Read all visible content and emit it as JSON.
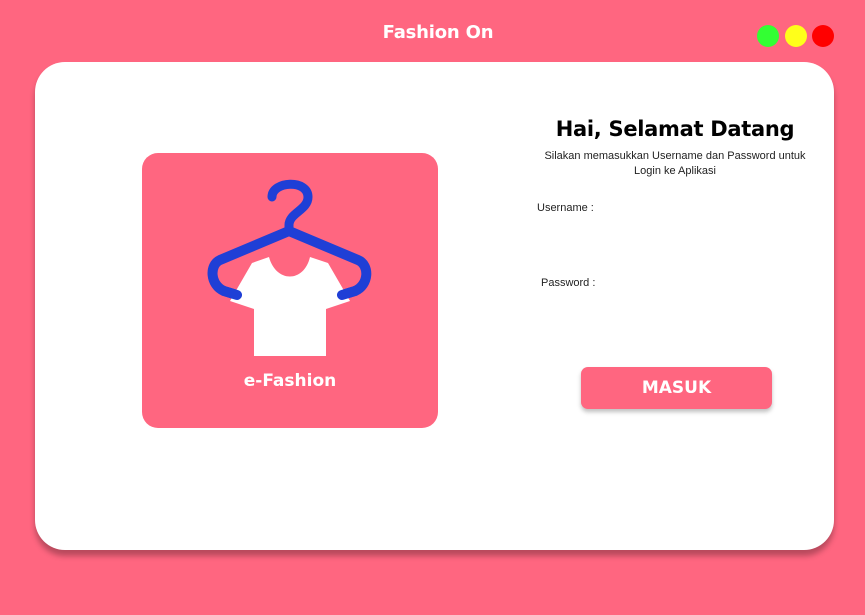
{
  "window": {
    "title": "Fashion On",
    "controls": {
      "green": "#33ff33",
      "yellow": "#ffff1a",
      "red": "#ff0000"
    }
  },
  "colors": {
    "background": "#ff6680",
    "card": "#ffffff",
    "hanger": "#1f3fd6",
    "logo_box": "#ff6680"
  },
  "logo": {
    "icon": "hanger-shirt-icon",
    "text": "e-Fashion"
  },
  "login": {
    "heading": "Hai, Selamat Datang",
    "subtitle_line1": "Silakan memasukkan Username dan Password untuk",
    "subtitle_line2": "Login ke Aplikasi",
    "username_label": "Username :",
    "username_value": "",
    "password_label": "Password :",
    "password_value": "",
    "submit_label": "MASUK"
  }
}
